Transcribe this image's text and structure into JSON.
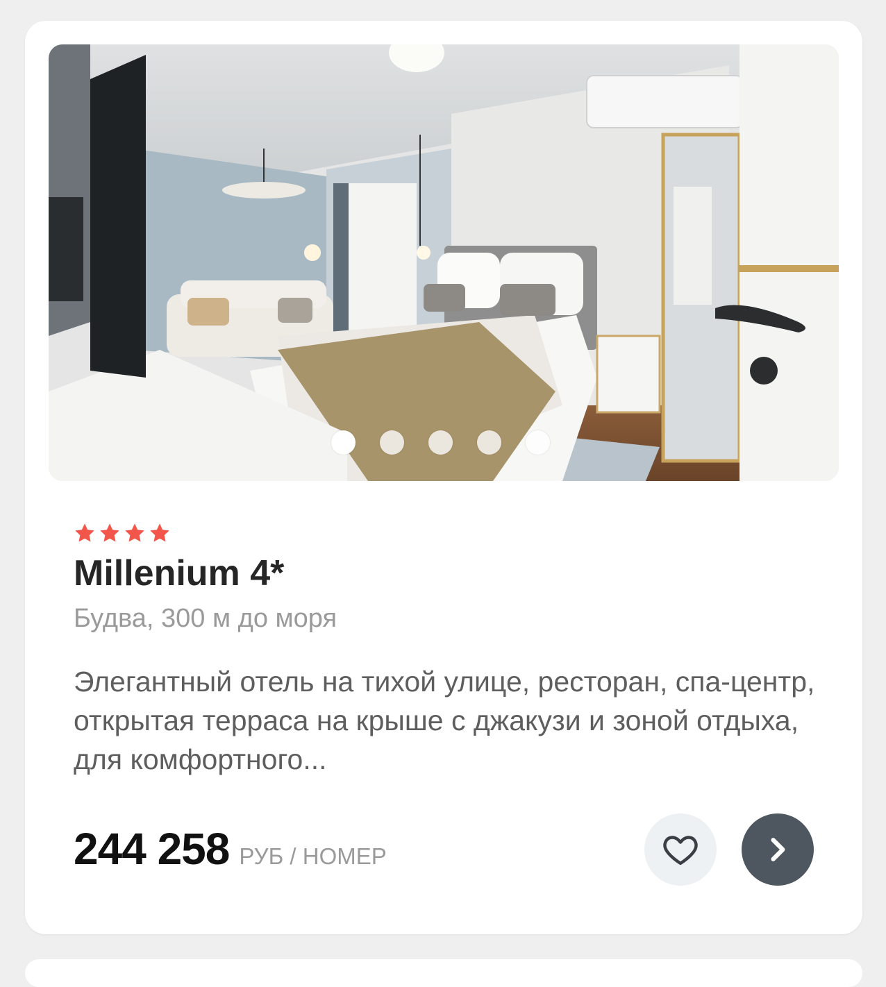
{
  "card": {
    "photo": {
      "description_icon": "hotel-room-photo",
      "slides_total": 5,
      "active_slide": 1
    },
    "rating": {
      "stars": 4,
      "star_color": "#f2564a"
    },
    "title": "Millenium 4*",
    "location": "Будва, 300 м до моря",
    "description": "Элегантный отель на тихой улице, ресторан, спа-центр, открытая терраса на крыше с джакузи и зоной отдыха, для комфортного...",
    "price": {
      "amount": "244 258",
      "unit": "РУБ / НОМЕР"
    },
    "actions": {
      "favorite_icon": "heart-outline-icon",
      "open_icon": "chevron-right-icon",
      "open_button_color": "#4e5660"
    }
  }
}
